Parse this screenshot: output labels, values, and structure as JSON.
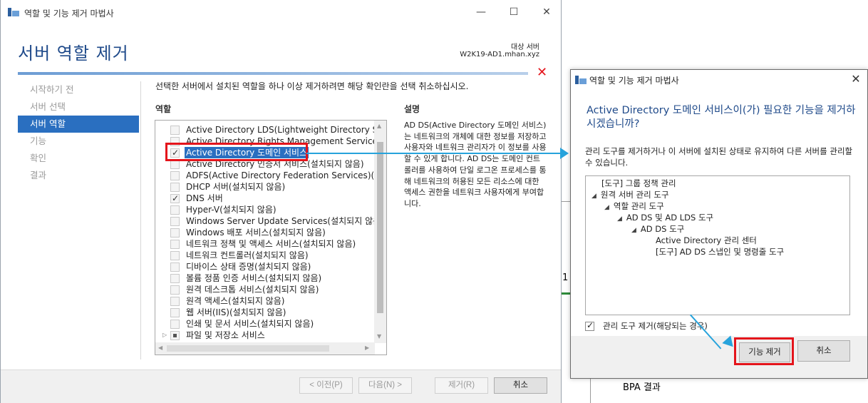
{
  "window": {
    "title": "역할 및 기능 제거 마법사",
    "minimize": "—",
    "maximize": "☐",
    "close": "✕"
  },
  "header": {
    "title": "서버 역할 제거",
    "target_label": "대상 서버",
    "target_server": "W2K19-AD1.mhan.xyz"
  },
  "nav": {
    "items": [
      "시작하기 전",
      "서버 선택",
      "서버 역할",
      "기능",
      "확인",
      "결과"
    ],
    "active_index": 2
  },
  "main": {
    "instruction": "선택한 서버에서 설치된 역할을 하나 이상 제거하려면 해당 확인란을 선택 취소하십시오.",
    "roles_heading": "역할",
    "description_heading": "설명",
    "description": "AD DS(Active Directory 도메인 서비스)는 네트워크의 개체에 대한 정보를 저장하고 사용자와 네트워크 관리자가 이 정보를 사용할 수 있게 합니다. AD DS는 도메인 컨트롤러를 사용하여 단일 로그온 프로세스를 통해 네트워크의 허용된 모든 리소스에 대한 액세스 권한을 네트워크 사용자에게 부여합니다."
  },
  "roles": [
    {
      "label": "Active Directory LDS(Lightweight Directory Servic",
      "state": "unchecked"
    },
    {
      "label": "Active Directory Rights Management Services(설",
      "state": "unchecked"
    },
    {
      "label": "Active Directory 도메인 서비스",
      "state": "checked",
      "selected": true
    },
    {
      "label": "Active Directory 인증서 서비스(설치되지 않음)",
      "state": "unchecked"
    },
    {
      "label": "ADFS(Active Directory Federation Services)(설치되",
      "state": "unchecked"
    },
    {
      "label": "DHCP 서버(설치되지 않음)",
      "state": "unchecked"
    },
    {
      "label": "DNS 서버",
      "state": "checked"
    },
    {
      "label": "Hyper-V(설치되지 않음)",
      "state": "unchecked"
    },
    {
      "label": "Windows Server Update Services(설치되지 않음)",
      "state": "unchecked"
    },
    {
      "label": "Windows 배포 서비스(설치되지 않음)",
      "state": "unchecked"
    },
    {
      "label": "네트워크 정책 및 액세스 서비스(설치되지 않음)",
      "state": "unchecked"
    },
    {
      "label": "네트워크 컨트롤러(설치되지 않음)",
      "state": "unchecked"
    },
    {
      "label": "디바이스 상태 증명(설치되지 않음)",
      "state": "unchecked"
    },
    {
      "label": "볼륨 정품 인증 서비스(설치되지 않음)",
      "state": "unchecked"
    },
    {
      "label": "원격 데스크톱 서비스(설치되지 않음)",
      "state": "unchecked"
    },
    {
      "label": "원격 액세스(설치되지 않음)",
      "state": "unchecked"
    },
    {
      "label": "웹 서버(IIS)(설치되지 않음)",
      "state": "unchecked"
    },
    {
      "label": "인쇄 및 문서 서비스(설치되지 않음)",
      "state": "unchecked"
    },
    {
      "label": "파일 및 저장소 서비스",
      "state": "partial",
      "expander": "▷"
    }
  ],
  "footer": {
    "prev": "< 이전(P)",
    "next": "다음(N) >",
    "remove": "제거(R)",
    "cancel": "취소"
  },
  "dialog": {
    "title": "역할 및 기능 제거 마법사",
    "close": "✕",
    "heading": "Active Directory 도메인 서비스이(가) 필요한 기능을 제거하시겠습니까?",
    "body": "관리 도구를 제거하거나 이 서버에 설치된 상태로 유지하여 다른 서버를 관리할 수 있습니다.",
    "tree": [
      {
        "label": "[도구] 그룹 정책 관리",
        "level": 0,
        "toggle": ""
      },
      {
        "label": "원격 서버 관리 도구",
        "level": 0,
        "toggle": "◢"
      },
      {
        "label": "역할 관리 도구",
        "level": 1,
        "toggle": "◢"
      },
      {
        "label": "AD DS 및 AD LDS 도구",
        "level": 2,
        "toggle": "◢"
      },
      {
        "label": "AD DS 도구",
        "level": 3,
        "toggle": "◢"
      },
      {
        "label": "Active Directory 관리 센터",
        "level": 4,
        "toggle": ""
      },
      {
        "label": "[도구] AD DS 스냅인 및 명령줄 도구",
        "level": 4,
        "toggle": ""
      }
    ],
    "checkbox_label": "관리 도구 제거(해당되는 경우)",
    "remove_features": "기능 제거",
    "cancel": "취소"
  },
  "background": {
    "fragment_digit": "1",
    "fragment_bpa": "BPA 결과"
  },
  "colors": {
    "accent": "#2a6fc0",
    "heading": "#1f4a8a",
    "highlight_box": "#e4141b",
    "annotation_arrow": "#27a3dc"
  }
}
